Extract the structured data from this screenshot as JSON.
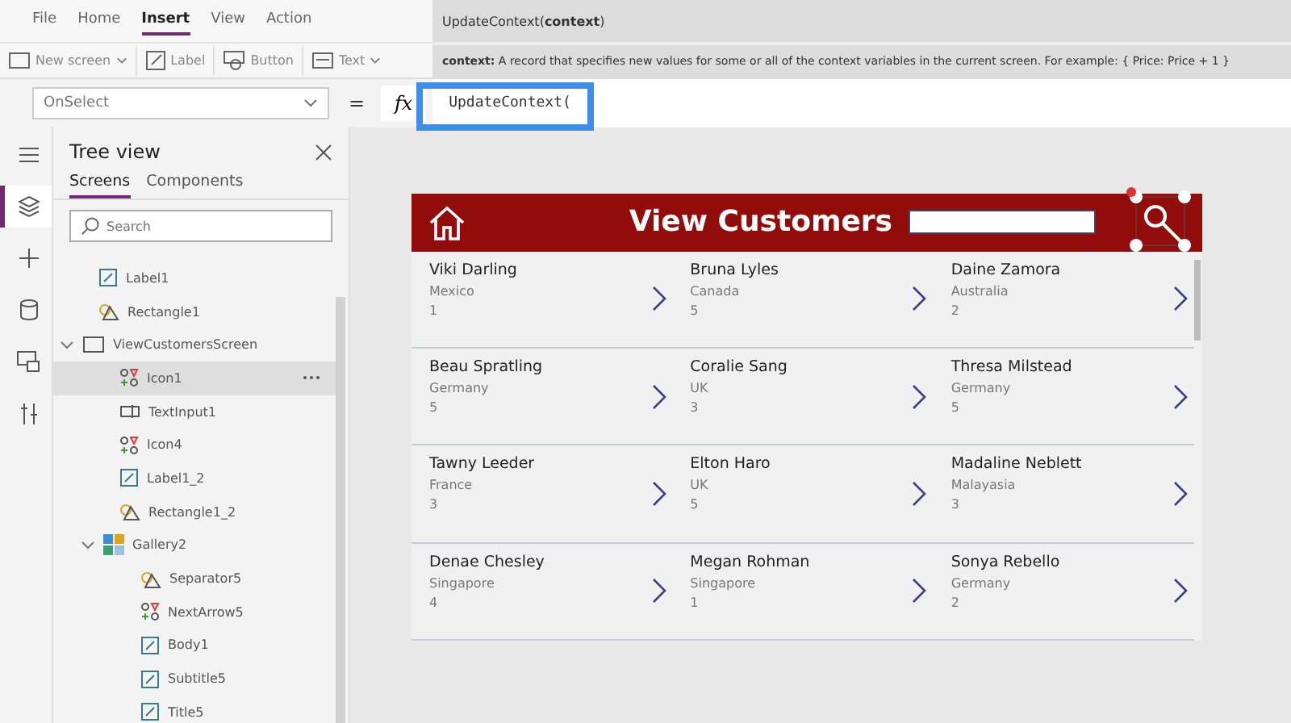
{
  "menu": [
    {
      "label": "File",
      "selected": false
    },
    {
      "label": "Home",
      "selected": false
    },
    {
      "label": "Insert",
      "selected": true
    },
    {
      "label": "View",
      "selected": false
    },
    {
      "label": "Action",
      "selected": false
    }
  ],
  "toolbar": [
    {
      "kind": "screen",
      "label": "New screen",
      "dropdown": true
    },
    {
      "kind": "label",
      "label": "Label",
      "dropdown": false
    },
    {
      "kind": "button",
      "label": "Button",
      "dropdown": false
    },
    {
      "kind": "text",
      "label": "Text",
      "dropdown": true
    }
  ],
  "tooltip": {
    "signature": "UpdateContext(**context**)",
    "description": "**context:** A record that specifies new values for some or all of the context variables in the current screen. For example: { Price: Price + 1 }"
  },
  "formula_bar": {
    "property": "OnSelect",
    "equals": "=",
    "fx": "fx",
    "formula": "UpdateContext("
  },
  "rail": [
    {
      "kind": "menu",
      "selected": false
    },
    {
      "kind": "layers",
      "selected": true
    },
    {
      "kind": "plus",
      "selected": false
    },
    {
      "kind": "data",
      "selected": false
    },
    {
      "kind": "media",
      "selected": false
    },
    {
      "kind": "tools",
      "selected": false
    }
  ],
  "tree_view": {
    "title": "Tree view",
    "tabs": [
      {
        "label": "Screens",
        "selected": true
      },
      {
        "label": "Components",
        "selected": false
      }
    ],
    "search": {
      "placeholder": "Search"
    },
    "items": [
      {
        "kind": "label",
        "label": "Label1",
        "selected": false
      },
      {
        "kind": "rectangle",
        "label": "Rectangle1",
        "selected": false
      },
      {
        "kind": "screen",
        "label": "ViewCustomersScreen",
        "selected": false,
        "expanded": true,
        "children": [
          {
            "kind": "icon",
            "label": "Icon1",
            "selected": true
          },
          {
            "kind": "textinput",
            "label": "TextInput1",
            "selected": false
          },
          {
            "kind": "icon",
            "label": "Icon4",
            "selected": false
          },
          {
            "kind": "label",
            "label": "Label1_2",
            "selected": false
          },
          {
            "kind": "rectangle",
            "label": "Rectangle1_2",
            "selected": false
          },
          {
            "kind": "gallery",
            "label": "Gallery2",
            "selected": false,
            "expanded": true,
            "children": [
              {
                "kind": "rectangle",
                "label": "Separator5",
                "selected": false
              },
              {
                "kind": "icon",
                "label": "NextArrow5",
                "selected": false
              },
              {
                "kind": "label",
                "label": "Body1",
                "selected": false
              },
              {
                "kind": "label",
                "label": "Subtitle5",
                "selected": false
              },
              {
                "kind": "label",
                "label": "Title5",
                "selected": false
              }
            ]
          }
        ]
      }
    ]
  },
  "app": {
    "title": "View Customers",
    "customers": [
      {
        "name": "Viki  Darling",
        "country": "Mexico",
        "rating": "1"
      },
      {
        "name": "Bruna  Lyles",
        "country": "Canada",
        "rating": "5"
      },
      {
        "name": "Daine  Zamora",
        "country": "Australia",
        "rating": "2"
      },
      {
        "name": "Beau  Spratling",
        "country": "Germany",
        "rating": "5"
      },
      {
        "name": "Coralie  Sang",
        "country": "UK",
        "rating": "3"
      },
      {
        "name": "Thresa  Milstead",
        "country": "Germany",
        "rating": "5"
      },
      {
        "name": "Tawny  Leeder",
        "country": "France",
        "rating": "3"
      },
      {
        "name": "Elton  Haro",
        "country": "UK",
        "rating": "5"
      },
      {
        "name": "Madaline  Neblett",
        "country": "Malayasia",
        "rating": "3"
      },
      {
        "name": "Denae  Chesley",
        "country": "Singapore",
        "rating": "4"
      },
      {
        "name": "Megan  Rohman",
        "country": "Singapore",
        "rating": "1"
      },
      {
        "name": "Sonya  Rebello",
        "country": "Germany",
        "rating": "2"
      }
    ]
  }
}
